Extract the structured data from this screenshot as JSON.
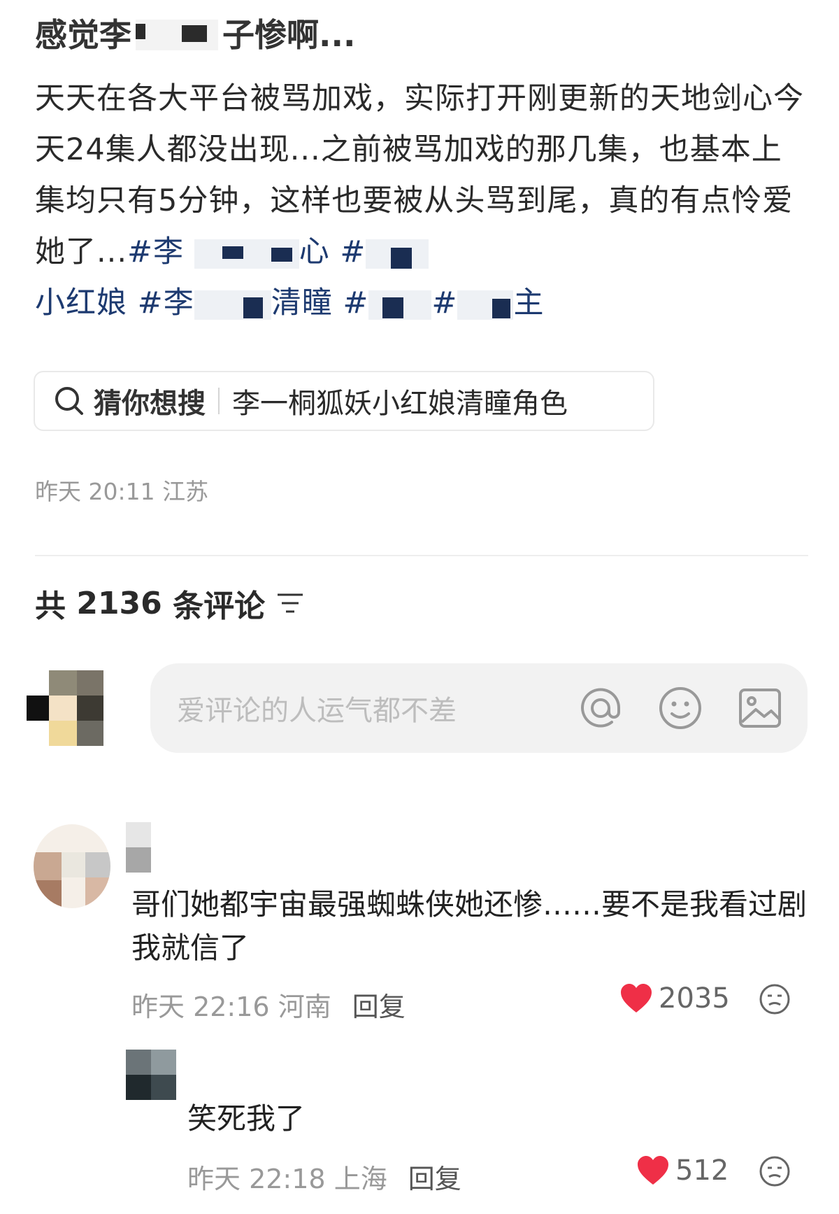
{
  "post": {
    "title_left": "感觉李",
    "title_right": "子惨啊...",
    "body_text": "天天在各大平台被骂加戏，实际打开刚更新的天地剑心今天24集人都没出现...之前被骂加戏的那几集，也基本上集均只有5分钟，这样也要被从头骂到尾，真的有点怜爱她了...",
    "tags": [
      "#李",
      "心",
      "#",
      "小红娘",
      "#李",
      "清瞳",
      "#",
      "#",
      "主"
    ],
    "meta_time": "昨天 20:11",
    "meta_location": "江苏"
  },
  "search": {
    "icon": "search-icon",
    "prefix": "猜你想搜",
    "suggestion": "李一桐狐妖小红娘清瞳角色"
  },
  "comments_header": {
    "prefix": "共",
    "count": "2136",
    "suffix": "条评论",
    "sort_icon": "sort-icon"
  },
  "input": {
    "placeholder": "爱评论的人运气都不差",
    "icons": [
      "at-icon",
      "emoji-icon",
      "image-icon"
    ]
  },
  "comments": [
    {
      "text": "哥们她都宇宙最强蜘蛛侠她还惨……要不是我看过剧我就信了",
      "time": "昨天 22:16",
      "location": "河南",
      "reply": "回复",
      "likes": "2035"
    },
    {
      "text": "笑死我了",
      "time": "昨天 22:18",
      "location": "上海",
      "reply": "回复",
      "likes": "512"
    }
  ],
  "colors": {
    "tag": "#1d3a70",
    "like": "#ef2f47",
    "meta": "#999999"
  }
}
